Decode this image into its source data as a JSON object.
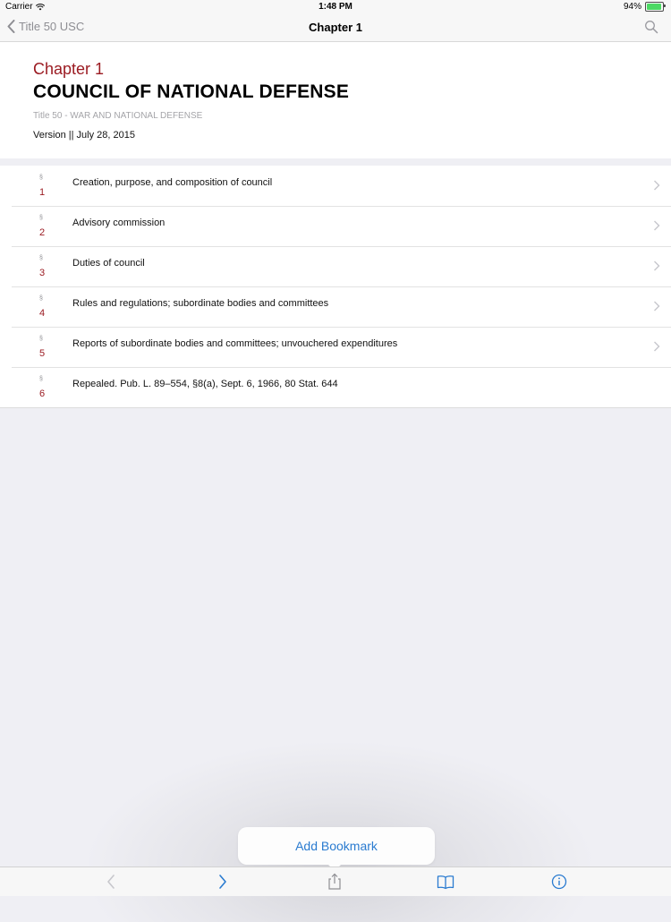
{
  "status_bar": {
    "carrier": "Carrier",
    "time": "1:48 PM",
    "battery_text": "94%",
    "battery_level": 0.94
  },
  "nav": {
    "back_label": "Title 50 USC",
    "title": "Chapter 1",
    "search_icon": "search-icon"
  },
  "header": {
    "chapter_label": "Chapter 1",
    "chapter_title": "COUNCIL OF NATIONAL DEFENSE",
    "subtitle": "Title 50 - WAR AND NATIONAL DEFENSE",
    "version": "Version || July 28, 2015"
  },
  "sections": [
    {
      "sign": "§",
      "number": "1",
      "text": "Creation, purpose, and composition of council",
      "has_chevron": true
    },
    {
      "sign": "§",
      "number": "2",
      "text": "Advisory commission",
      "has_chevron": true
    },
    {
      "sign": "§",
      "number": "3",
      "text": "Duties of council",
      "has_chevron": true
    },
    {
      "sign": "§",
      "number": "4",
      "text": "Rules and regulations; subordinate bodies and committees",
      "has_chevron": true
    },
    {
      "sign": "§",
      "number": "5",
      "text": "Reports of subordinate bodies and committees; unvouchered expenditures",
      "has_chevron": true
    },
    {
      "sign": "§",
      "number": "6",
      "text": "Repealed. Pub. L. 89–554, §8(a), Sept. 6, 1966, 80 Stat. 644",
      "has_chevron": false
    }
  ],
  "popover": {
    "add_bookmark_label": "Add Bookmark"
  },
  "toolbar": {
    "icons": [
      "back-arrow-icon",
      "forward-arrow-icon",
      "share-icon",
      "book-icon",
      "info-icon"
    ]
  },
  "colors": {
    "accent_red": "#9b1b22",
    "link_blue": "#2a7bd0",
    "battery_green": "#4cd964",
    "background": "#efeff4"
  }
}
